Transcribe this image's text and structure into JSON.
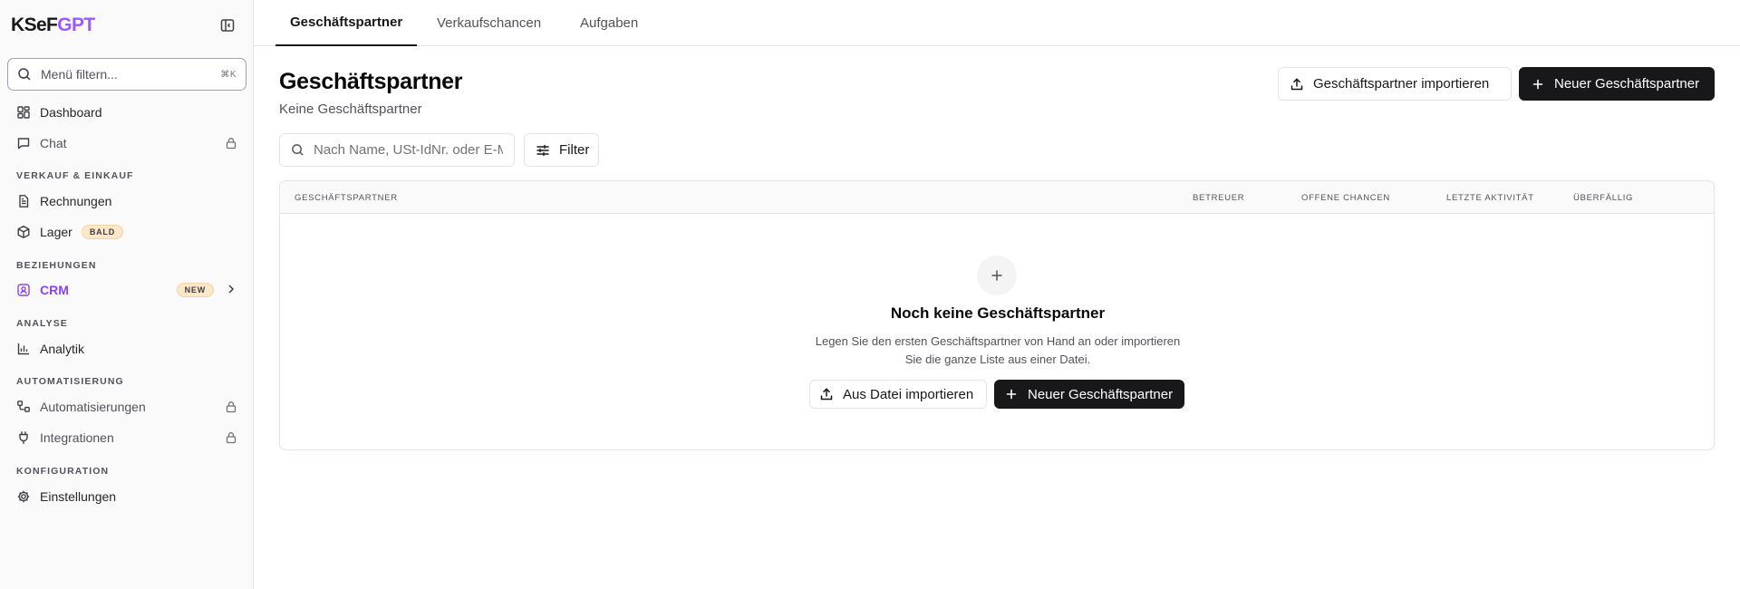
{
  "app": {
    "logo_main": "KSeF",
    "logo_accent": "GPT",
    "accent_color": "#9b5cf6"
  },
  "sidebar": {
    "filter_placeholder": "Menü filtern...",
    "filter_shortcut": "⌘K",
    "dashboard_label": "Dashboard",
    "chat_label": "Chat",
    "section_sales": "VERKAUF & EINKAUF",
    "invoices_label": "Rechnungen",
    "stock_label": "Lager",
    "stock_badge": "BALD",
    "section_relations": "BEZIEHUNGEN",
    "crm_label": "CRM",
    "crm_badge": "NEW",
    "section_analysis": "ANALYSE",
    "analytics_label": "Analytik",
    "section_automation": "AUTOMATISIERUNG",
    "automations_label": "Automatisierungen",
    "integrations_label": "Integrationen",
    "section_config": "KONFIGURATION",
    "settings_label": "Einstellungen"
  },
  "tabs": {
    "partners": "Geschäftspartner",
    "opportunities": "Verkaufschancen",
    "tasks": "Aufgaben"
  },
  "header": {
    "title": "Geschäftspartner",
    "subtitle": "Keine Geschäftspartner",
    "import_label": "Geschäftspartner importieren",
    "new_label": "Neuer Geschäftspartner"
  },
  "toolbar": {
    "search_placeholder": "Nach Name, USt-IdNr. oder E-Mail suchen",
    "filter_label": "Filter"
  },
  "table": {
    "col_partner": "GESCHÄFTSPARTNER",
    "col_owner": "BETREUER",
    "col_open_chances": "OFFENE CHANCEN",
    "col_last_activity": "LETZTE AKTIVITÄT",
    "col_overdue": "ÜBERFÄLLIG"
  },
  "empty_state": {
    "title": "Noch keine Geschäftspartner",
    "desc_line1": "Legen Sie den ersten Geschäftspartner von Hand an oder importieren",
    "desc_line2": "Sie die ganze Liste aus einer Datei.",
    "import_label": "Aus Datei importieren",
    "new_label": "Neuer Geschäftspartner"
  },
  "icons": {
    "search": "search-icon",
    "sidebar_toggle": "sidebar-toggle-icon",
    "dashboard": "grid-icon",
    "chat": "chat-icon",
    "invoices": "file-icon",
    "stock": "box-icon",
    "crm": "contact-icon",
    "analytics": "bar-chart-icon",
    "automations": "workflow-icon",
    "integrations": "plug-icon",
    "settings": "gear-icon",
    "lock": "lock-icon",
    "chevron": "chevron-right-icon",
    "upload": "upload-icon",
    "plus": "plus-icon",
    "filter": "sliders-icon"
  }
}
